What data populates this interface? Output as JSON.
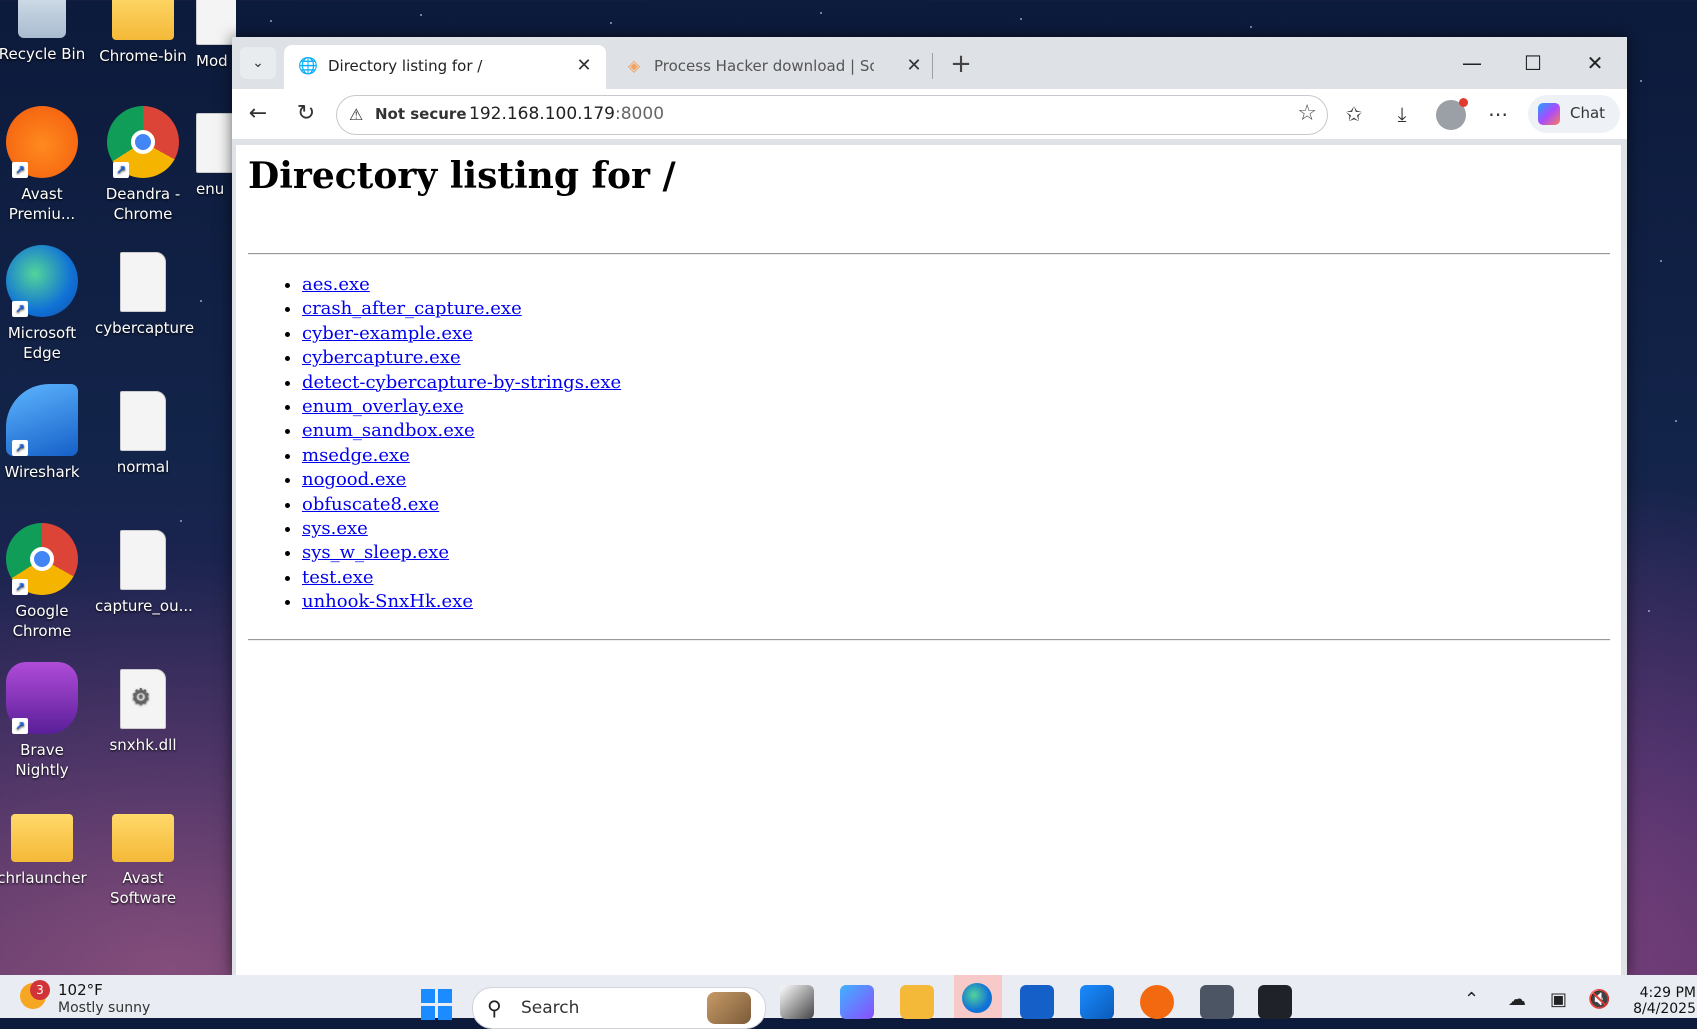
{
  "desktop": {
    "icons": [
      {
        "label": "Recycle Bin"
      },
      {
        "label": "Chrome-bin"
      },
      {
        "label": "Mod"
      },
      {
        "label": "Avast Premiu..."
      },
      {
        "label": "Deandra - Chrome"
      },
      {
        "label": "enu"
      },
      {
        "label": "Microsoft Edge"
      },
      {
        "label": "cybercapture"
      },
      {
        "label": "Wireshark"
      },
      {
        "label": "normal"
      },
      {
        "label": "Google Chrome"
      },
      {
        "label": "capture_ou..."
      },
      {
        "label": "Brave Nightly"
      },
      {
        "label": "snxhk.dll"
      },
      {
        "label": "chrlauncher"
      },
      {
        "label": "Avast Software"
      }
    ]
  },
  "browser": {
    "tabs": [
      {
        "title": "Directory listing for /",
        "active": true
      },
      {
        "title": "Process Hacker download | Source",
        "active": false
      }
    ],
    "address": {
      "security_label": "Not secure",
      "host": "192.168.100.179",
      "port": ":8000"
    },
    "chat_label": "Chat",
    "page": {
      "heading": "Directory listing for /",
      "files": [
        "aes.exe",
        "crash_after_capture.exe",
        "cyber-example.exe",
        "cybercapture.exe",
        "detect-cybercapture-by-strings.exe",
        "enum_overlay.exe",
        "enum_sandbox.exe",
        "msedge.exe",
        "nogood.exe",
        "obfuscate8.exe",
        "sys.exe",
        "sys_w_sleep.exe",
        "test.exe",
        "unhook-SnxHk.exe"
      ]
    }
  },
  "taskbar": {
    "weather": {
      "temp": "102°F",
      "condition": "Mostly sunny",
      "badge": "3"
    },
    "search_placeholder": "Search",
    "clock": {
      "time": "4:29 PM",
      "date": "8/4/2025"
    }
  },
  "colors": {
    "link": "#0000ee",
    "accent": "#1a8cff",
    "badge": "#d13438"
  }
}
